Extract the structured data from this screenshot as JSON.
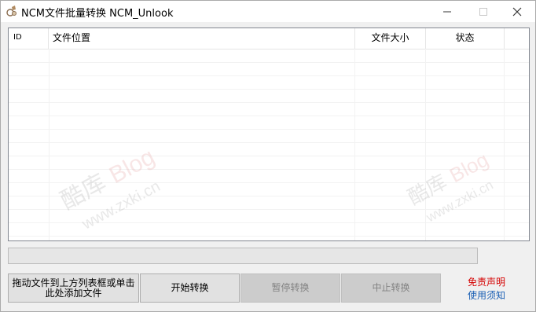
{
  "window": {
    "title": "NCM文件批量转换 NCM_Unlook",
    "controls": {
      "minimize": "—",
      "maximize": "☐",
      "close": "✕"
    }
  },
  "list": {
    "columns": [
      {
        "label": "ID"
      },
      {
        "label": "文件位置"
      },
      {
        "label": "文件大小"
      },
      {
        "label": "状态"
      }
    ],
    "rows": []
  },
  "watermark": {
    "brand_cn": "酷库",
    "brand_en": "Blog",
    "url": "www.zxki.cn"
  },
  "buttons": {
    "drop_add": "拖动文件到上方列表框或单击此处添加文件",
    "start": "开始转换",
    "pause": "暂停转换",
    "stop": "中止转换"
  },
  "links": {
    "disclaimer": "免责声明",
    "notice": "使用须知"
  },
  "colors": {
    "disclaimer": "#d40000",
    "notice": "#1a5fb4"
  }
}
